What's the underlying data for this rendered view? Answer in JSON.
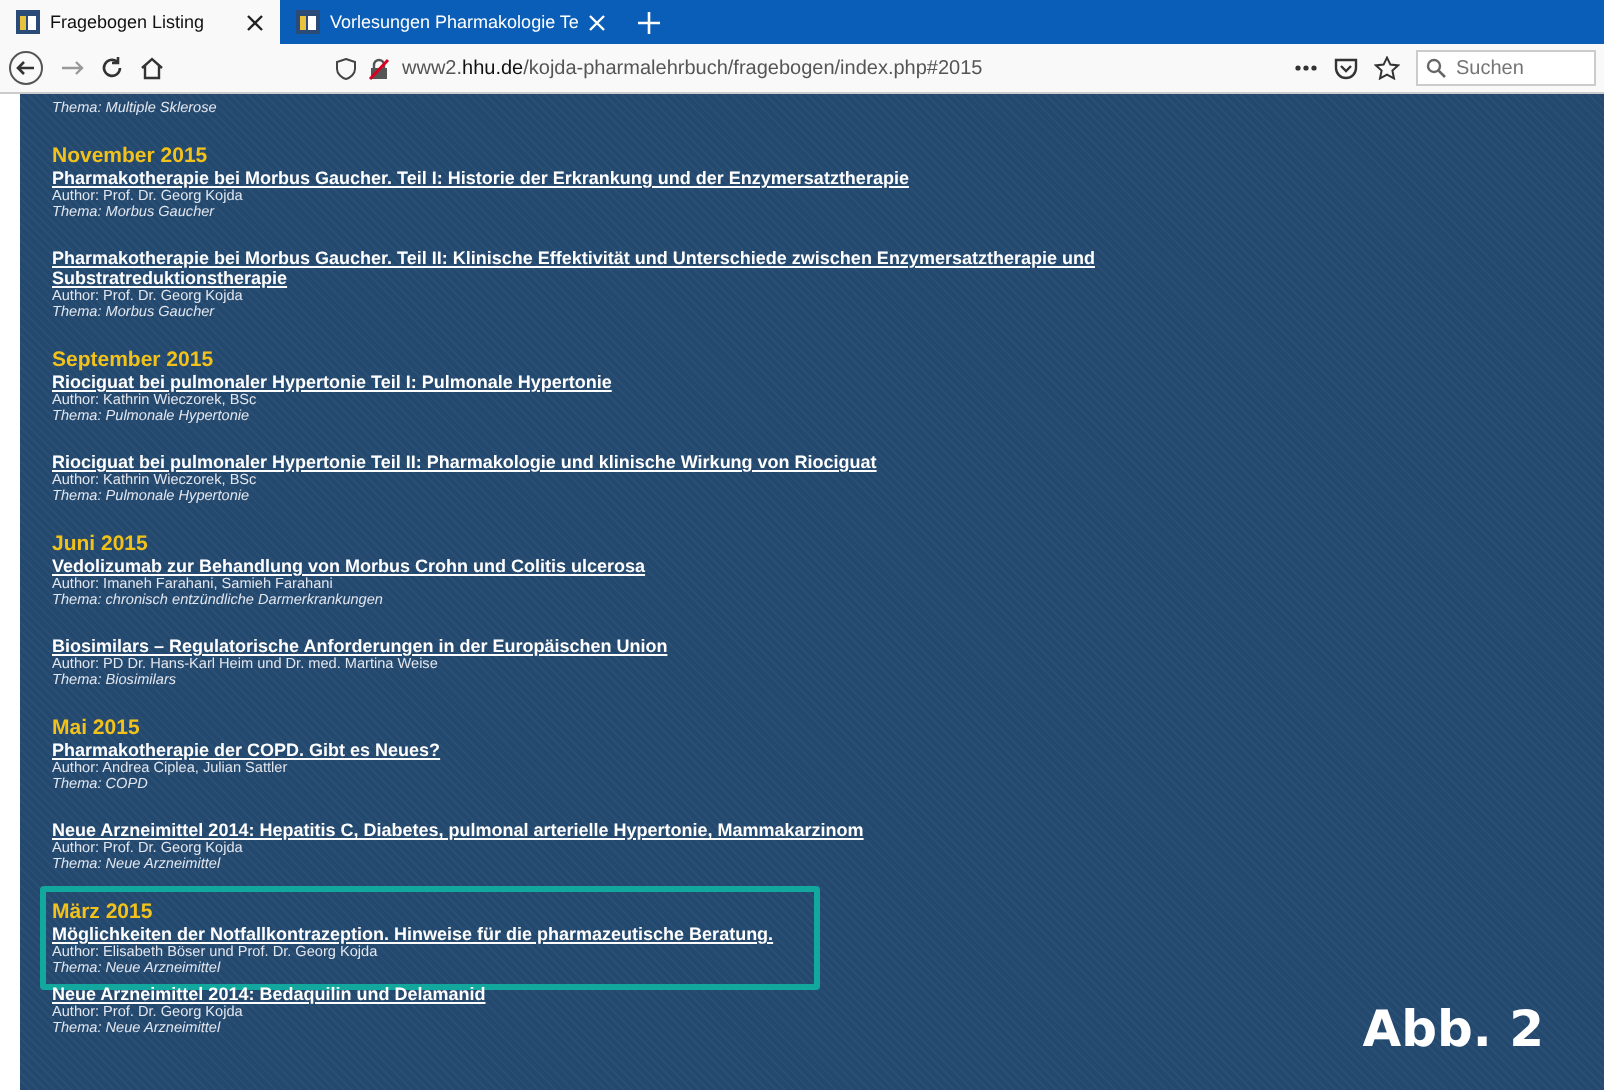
{
  "tabs": [
    {
      "label": "Fragebogen Listing",
      "selected": true
    },
    {
      "label": "Vorlesungen Pharmakologie Te",
      "selected": false
    }
  ],
  "address_bar": {
    "url": "www2.**hhu.de**/kojda-pharmalehrbuch/fragebogen/index.php#2015"
  },
  "search": {
    "placeholder": "Suchen"
  },
  "top_fragment": {
    "theme": "Thema: Multiple Sklerose"
  },
  "sections": [
    {
      "heading": "November 2015",
      "highlighted": false,
      "entries": [
        {
          "title": "Pharmakotherapie bei Morbus Gaucher. Teil I: Historie der Erkrankung und der Enzymersatztherapie",
          "author": "Author: Prof. Dr. Georg Kojda",
          "theme": "Thema: Morbus Gaucher"
        },
        {
          "title": "Pharmakotherapie bei Morbus Gaucher. Teil II: Klinische Effektivität und Unterschiede zwischen Enzymersatztherapie und Substratreduktionstherapie",
          "author": "Author: Prof. Dr. Georg Kojda",
          "theme": "Thema: Morbus Gaucher"
        }
      ]
    },
    {
      "heading": "September 2015",
      "highlighted": false,
      "entries": [
        {
          "title": "Riociguat bei pulmonaler Hypertonie Teil I: Pulmonale Hypertonie",
          "author": "Author: Kathrin Wieczorek, BSc",
          "theme": "Thema: Pulmonale Hypertonie"
        },
        {
          "title": "Riociguat bei pulmonaler Hypertonie Teil II: Pharmakologie und klinische Wirkung von Riociguat",
          "author": "Author: Kathrin Wieczorek, BSc",
          "theme": "Thema: Pulmonale Hypertonie"
        }
      ]
    },
    {
      "heading": "Juni 2015",
      "highlighted": false,
      "entries": [
        {
          "title": "Vedolizumab zur Behandlung von Morbus Crohn und Colitis ulcerosa",
          "author": "Author: Imaneh Farahani, Samieh Farahani",
          "theme": "Thema: chronisch entzündliche Darmerkrankungen"
        },
        {
          "title": "Biosimilars – Regulatorische Anforderungen in der Europäischen Union",
          "author": "Author: PD Dr. Hans-Karl Heim und Dr. med. Martina Weise",
          "theme": "Thema: Biosimilars"
        }
      ]
    },
    {
      "heading": "Mai 2015",
      "highlighted": false,
      "entries": [
        {
          "title": "Pharmakotherapie der COPD. Gibt es Neues?",
          "author": "Author: Andrea Ciplea, Julian Sattler",
          "theme": "Thema: COPD"
        },
        {
          "title": "Neue Arzneimittel 2014: Hepatitis C, Diabetes, pulmonal arterielle Hypertonie, Mammakarzinom",
          "author": "Author: Prof. Dr. Georg Kojda",
          "theme": "Thema: Neue Arzneimittel"
        }
      ]
    },
    {
      "heading": "März 2015",
      "highlighted": true,
      "entries": [
        {
          "title": "Möglichkeiten der Notfallkontrazeption. Hinweise für die pharmazeutische Beratung.",
          "author": "Author: Elisabeth Böser und Prof. Dr. Georg Kojda",
          "theme": "Thema: Neue Arzneimittel"
        }
      ]
    },
    {
      "highlighted": false,
      "entries": [
        {
          "title": "Neue Arzneimittel 2014: Bedaquilin und Delamanid",
          "author": "Author: Prof. Dr. Georg Kojda",
          "theme": "Thema: Neue Arzneimittel"
        }
      ]
    }
  ],
  "figure_label": "Abb. 2"
}
